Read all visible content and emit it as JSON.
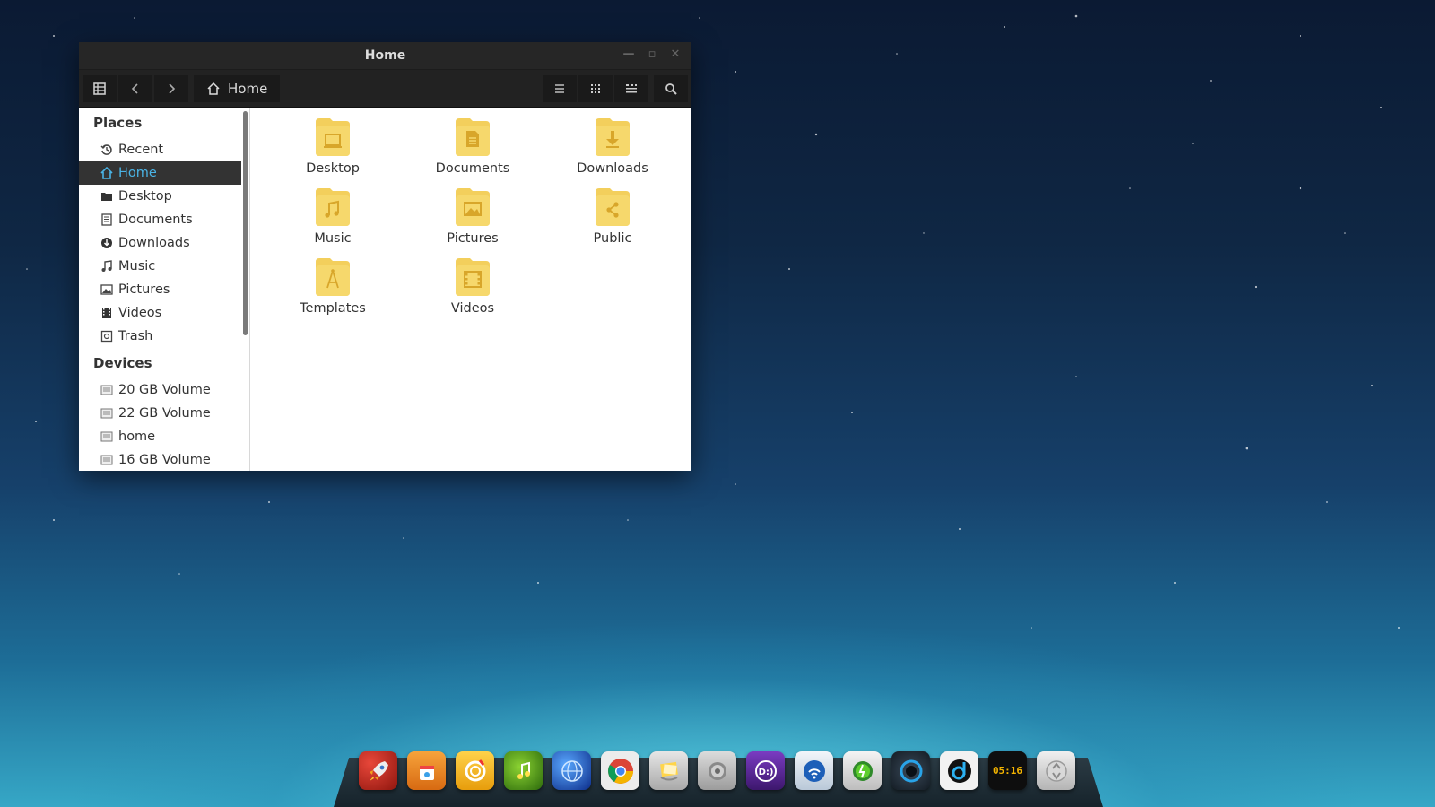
{
  "window": {
    "title": "Home",
    "breadcrumb": "Home",
    "controls": {
      "minimize": "—",
      "maximize": "▫",
      "close": "✕"
    }
  },
  "sidebar": {
    "places_header": "Places",
    "places": [
      {
        "label": "Recent",
        "icon": "recent-icon"
      },
      {
        "label": "Home",
        "icon": "home-icon",
        "active": true
      },
      {
        "label": "Desktop",
        "icon": "desktop-folder-icon"
      },
      {
        "label": "Documents",
        "icon": "documents-icon"
      },
      {
        "label": "Downloads",
        "icon": "downloads-icon"
      },
      {
        "label": "Music",
        "icon": "music-icon"
      },
      {
        "label": "Pictures",
        "icon": "pictures-icon"
      },
      {
        "label": "Videos",
        "icon": "videos-icon"
      },
      {
        "label": "Trash",
        "icon": "trash-icon"
      }
    ],
    "devices_header": "Devices",
    "devices": [
      {
        "label": "20 GB Volume",
        "icon": "drive-icon"
      },
      {
        "label": "22 GB Volume",
        "icon": "drive-icon"
      },
      {
        "label": "home",
        "icon": "drive-icon"
      },
      {
        "label": "16 GB Volume",
        "icon": "drive-icon"
      }
    ]
  },
  "files": [
    {
      "label": "Desktop",
      "icon": "desktop-folder-icon"
    },
    {
      "label": "Documents",
      "icon": "documents-folder-icon"
    },
    {
      "label": "Downloads",
      "icon": "downloads-folder-icon"
    },
    {
      "label": "Music",
      "icon": "music-folder-icon"
    },
    {
      "label": "Pictures",
      "icon": "pictures-folder-icon"
    },
    {
      "label": "Public",
      "icon": "public-folder-icon"
    },
    {
      "label": "Templates",
      "icon": "templates-folder-icon"
    },
    {
      "label": "Videos",
      "icon": "videos-folder-icon"
    }
  ],
  "dock": {
    "clock": "05:16",
    "apps": [
      {
        "name": "launcher-rocket-icon",
        "color": "#c0281c"
      },
      {
        "name": "store-icon",
        "color": "#f08a1c"
      },
      {
        "name": "burner-icon",
        "color": "#f3b21a"
      },
      {
        "name": "music-player-icon",
        "color": "#5aa01a"
      },
      {
        "name": "browser-globe-icon",
        "color": "#1f55c8"
      },
      {
        "name": "chrome-icon",
        "color": "#e9e9e9"
      },
      {
        "name": "notes-icon",
        "color": "#cfcfcf"
      },
      {
        "name": "settings-icon",
        "color": "#bdbdbd"
      },
      {
        "name": "deepin-d-icon",
        "color": "#5a2a9a"
      },
      {
        "name": "network-icon",
        "color": "#dfe6ee"
      },
      {
        "name": "power-icon",
        "color": "#e3e3e3"
      },
      {
        "name": "camera-lens-icon",
        "color": "#2a3440"
      },
      {
        "name": "deepin-music-icon",
        "color": "#e6e6e6"
      },
      {
        "name": "clock-icon",
        "color": "#111111"
      },
      {
        "name": "recycle-bin-icon",
        "color": "#d6d6d6"
      }
    ]
  },
  "colors": {
    "accent": "#4ab4e6",
    "folder": "#f3cf5c",
    "titlebar": "#262626"
  }
}
